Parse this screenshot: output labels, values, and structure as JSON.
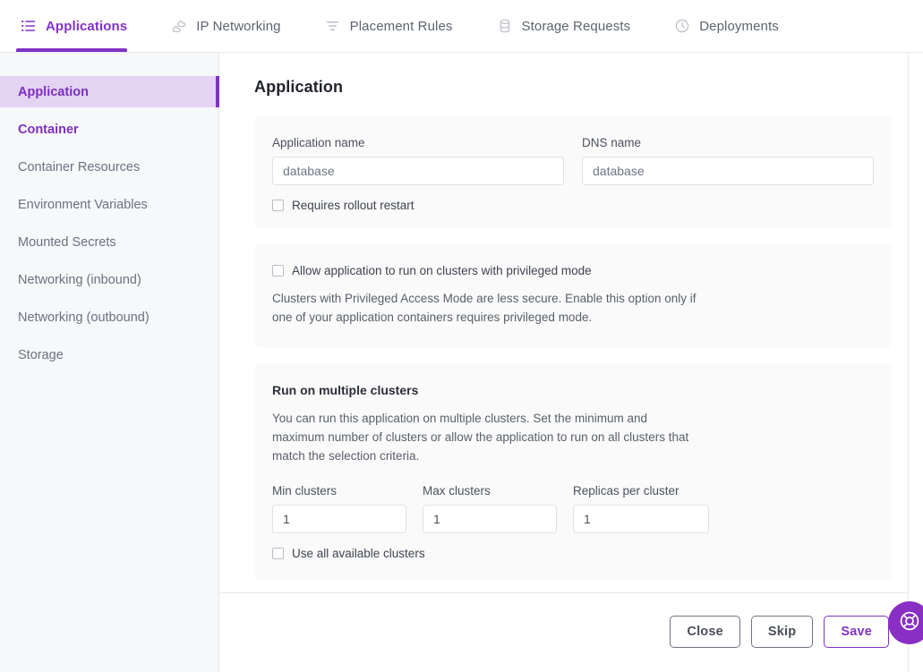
{
  "tabs": [
    {
      "label": "Applications",
      "icon": "list-icon",
      "active": true
    },
    {
      "label": "IP Networking",
      "icon": "network-nodes-icon",
      "active": false
    },
    {
      "label": "Placement Rules",
      "icon": "filter-icon",
      "active": false
    },
    {
      "label": "Storage Requests",
      "icon": "database-icon",
      "active": false
    },
    {
      "label": "Deployments",
      "icon": "clock-icon",
      "active": false
    }
  ],
  "sidebar": {
    "items": [
      {
        "label": "Application",
        "state": "active"
      },
      {
        "label": "Container",
        "state": "link"
      },
      {
        "label": "Container Resources",
        "state": "default"
      },
      {
        "label": "Environment Variables",
        "state": "default"
      },
      {
        "label": "Mounted Secrets",
        "state": "default"
      },
      {
        "label": "Networking (inbound)",
        "state": "default"
      },
      {
        "label": "Networking (outbound)",
        "state": "default"
      },
      {
        "label": "Storage",
        "state": "default"
      }
    ]
  },
  "main": {
    "title": "Application",
    "app_name": {
      "label": "Application name",
      "value": "database"
    },
    "dns_name": {
      "label": "DNS name",
      "value": "database"
    },
    "rollout_restart": {
      "label": "Requires rollout restart",
      "checked": false
    },
    "privileged": {
      "label": "Allow application to run on clusters with privileged mode",
      "checked": false,
      "help": "Clusters with Privileged Access Mode are less secure. Enable this option only if one of your application containers requires privileged mode."
    },
    "multi_cluster": {
      "heading": "Run on multiple clusters",
      "help": "You can run this application on multiple clusters. Set the minimum and maximum number of clusters or allow the application to run on all clusters that match the selection criteria.",
      "min_clusters": {
        "label": "Min clusters",
        "value": "1"
      },
      "max_clusters": {
        "label": "Max clusters",
        "value": "1"
      },
      "replicas_per_cluster": {
        "label": "Replicas per cluster",
        "value": "1"
      },
      "use_all": {
        "label": "Use all available clusters",
        "checked": false
      }
    }
  },
  "footer": {
    "close_label": "Close",
    "skip_label": "Skip",
    "save_label": "Save"
  },
  "help_fab": {
    "icon": "lifebuoy-icon"
  },
  "colors": {
    "accent": "#8033c7",
    "accent_soft": "#e4d3f3",
    "card_bg": "#fafafb",
    "sidebar_bg": "#f7f8fa",
    "border": "#e6e8ec",
    "text": "#3f444e",
    "muted": "#6b7280"
  }
}
